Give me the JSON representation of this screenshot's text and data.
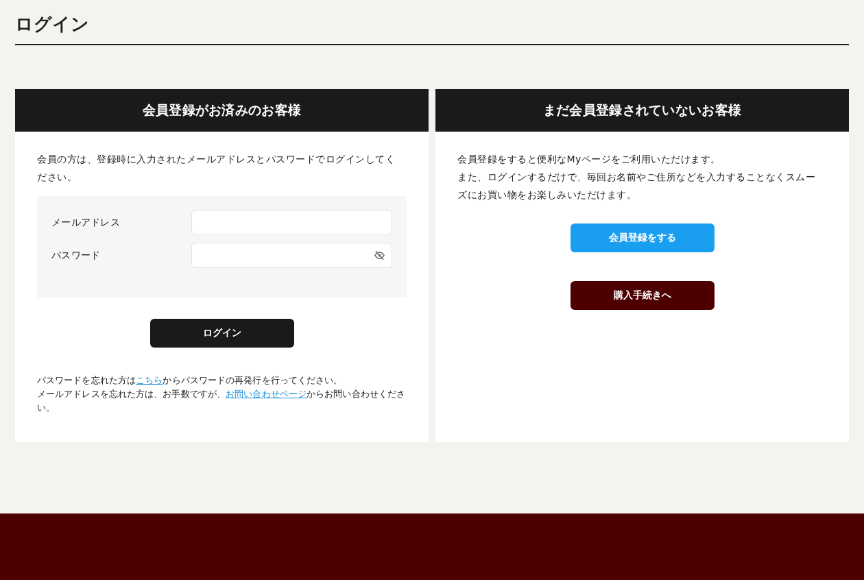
{
  "page": {
    "title": "ログイン"
  },
  "member_panel": {
    "title": "会員登録がお済みのお客様",
    "intro": "会員の方は、登録時に入力されたメールアドレスとパスワードでログインしてください。",
    "fields": [
      {
        "label": "メールアドレス",
        "kind": "email"
      },
      {
        "label": "パスワード",
        "kind": "password"
      }
    ],
    "submit": {
      "label": "ログイン"
    },
    "notes": [
      {
        "before": "パスワードを忘れた方は",
        "link": "こちら",
        "after": "からパスワードの再発行を行ってください。"
      },
      {
        "before": "メールアドレスを忘れた方は、お手数ですが、",
        "link": "お問い合わせページ",
        "after": "からお問い合わせください。"
      }
    ]
  },
  "guest_panel": {
    "title": "まだ会員登録されていないお客様",
    "intro": [
      "会員登録をすると便利なMyページをご利用いただけます。",
      "また、ログインするだけで、毎回お名前やご住所などを入力することなくスムーズにお買い物をお楽しみいただけます。"
    ],
    "buttons": [
      {
        "label": "会員登録をする",
        "kind": "register"
      },
      {
        "label": "購入手続きへ",
        "kind": "checkout"
      }
    ]
  }
}
